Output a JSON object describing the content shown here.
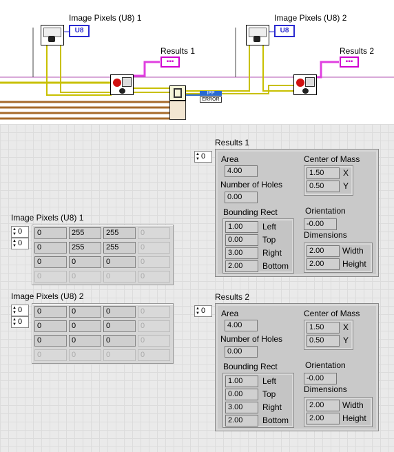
{
  "diagram": {
    "top_left_label": "Image Pixels (U8) 1",
    "top_right_label": "Image Pixels (U8) 2",
    "results1_label": "Results 1",
    "results2_label": "Results 2",
    "u8_terminal": "U8",
    "ipp_label": "IPP",
    "error_label": "ERROR"
  },
  "image1": {
    "label": "Image Pixels (U8) 1",
    "row_index": "0",
    "col_index": "0",
    "rows": [
      [
        "0",
        "255",
        "255",
        "0"
      ],
      [
        "0",
        "255",
        "255",
        "0"
      ],
      [
        "0",
        "0",
        "0",
        "0"
      ],
      [
        "0",
        "0",
        "0",
        "0"
      ]
    ]
  },
  "image2": {
    "label": "Image Pixels (U8) 2",
    "row_index": "0",
    "col_index": "0",
    "rows": [
      [
        "0",
        "0",
        "0",
        "0"
      ],
      [
        "0",
        "0",
        "0",
        "0"
      ],
      [
        "0",
        "0",
        "0",
        "0"
      ],
      [
        "0",
        "0",
        "0",
        "0"
      ]
    ]
  },
  "results1": {
    "label": "Results 1",
    "index": "0",
    "area_label": "Area",
    "area": "4.00",
    "holes_label": "Number of Holes",
    "holes": "0.00",
    "bbox_label": "Bounding Rect",
    "left": "1.00",
    "left_label": "Left",
    "top": "0.00",
    "top_label": "Top",
    "right": "3.00",
    "right_label": "Right",
    "bottom": "2.00",
    "bottom_label": "Bottom",
    "com_label": "Center of Mass",
    "x": "1.50",
    "x_label": "X",
    "y": "0.50",
    "y_label": "Y",
    "orient_label": "Orientation",
    "orient": "-0.00",
    "dims_label": "Dimensions",
    "width": "2.00",
    "width_label": "Width",
    "height": "2.00",
    "height_label": "Height"
  },
  "results2": {
    "label": "Results 2",
    "index": "0",
    "area_label": "Area",
    "area": "4.00",
    "holes_label": "Number of Holes",
    "holes": "0.00",
    "bbox_label": "Bounding Rect",
    "left": "1.00",
    "left_label": "Left",
    "top": "0.00",
    "top_label": "Top",
    "right": "3.00",
    "right_label": "Right",
    "bottom": "2.00",
    "bottom_label": "Bottom",
    "com_label": "Center of Mass",
    "x": "1.50",
    "x_label": "X",
    "y": "0.50",
    "y_label": "Y",
    "orient_label": "Orientation",
    "orient": "-0.00",
    "dims_label": "Dimensions",
    "width": "2.00",
    "width_label": "Width",
    "height": "2.00",
    "height_label": "Height"
  }
}
